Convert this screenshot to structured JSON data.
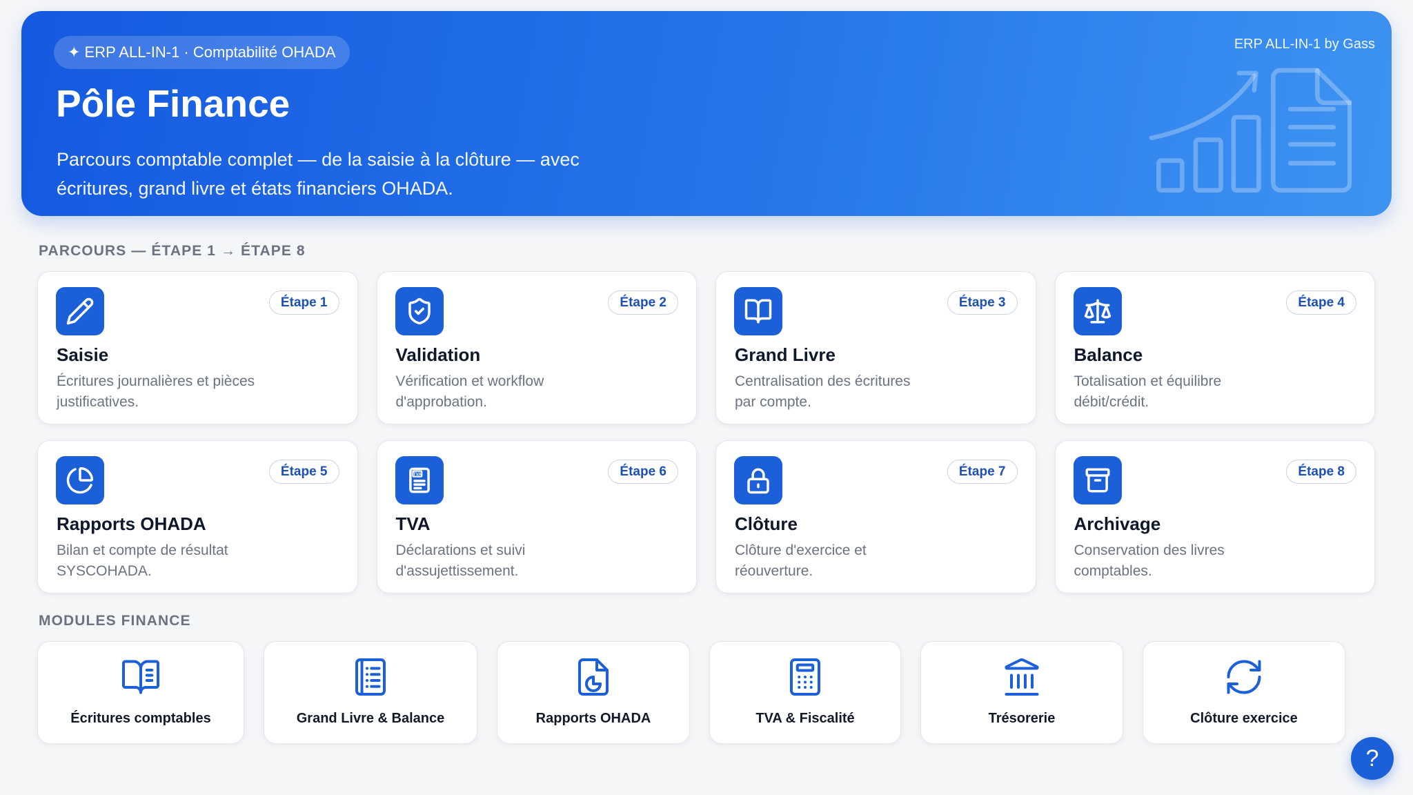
{
  "colors": {
    "accent": "#1b5fd9",
    "header_gradient_start": "#1559e0",
    "header_gradient_mid": "#2676ea",
    "header_gradient_end": "#3e93f1",
    "page_background": "#f5f6f8",
    "step_badge_text": "#1d4fb8"
  },
  "header": {
    "badge": "✦ ERP ALL-IN-1 · Comptabilité OHADA",
    "title": "Pôle Finance",
    "subtitle": "Parcours comptable complet — de la saisie à la clôture — avec\nécritures, grand livre et états financiers OHADA.",
    "brand": "ERP ALL-IN-1 by Gass",
    "illustration_icon": "growth-chart-document-icon"
  },
  "journey": {
    "label": "PARCOURS — ÉTAPE 1 → ÉTAPE 8",
    "steps": [
      {
        "step": "Étape 1",
        "title": "Saisie",
        "desc": "Écritures journalières et pièces\njustificatives.",
        "icon": "pencil-icon"
      },
      {
        "step": "Étape 2",
        "title": "Validation",
        "desc": "Vérification et workflow\nd'approbation.",
        "icon": "shield-check-icon"
      },
      {
        "step": "Étape 3",
        "title": "Grand Livre",
        "desc": "Centralisation des écritures\npar compte.",
        "icon": "book-open-icon"
      },
      {
        "step": "Étape 4",
        "title": "Balance",
        "desc": "Totalisation et équilibre\ndébit/crédit.",
        "icon": "scale-icon"
      },
      {
        "step": "Étape 5",
        "title": "Rapports OHADA",
        "desc": "Bilan et compte de résultat\nSYSCOHADA.",
        "icon": "pie-chart-icon"
      },
      {
        "step": "Étape 6",
        "title": "TVA",
        "desc": "Déclarations et suivi\nd'assujettissement.",
        "icon": "tax-document-icon",
        "icon_label": "TVA"
      },
      {
        "step": "Étape 7",
        "title": "Clôture",
        "desc": "Clôture d'exercice et\nréouverture.",
        "icon": "lock-icon"
      },
      {
        "step": "Étape 8",
        "title": "Archivage",
        "desc": "Conservation des livres\ncomptables.",
        "icon": "archive-box-icon"
      }
    ]
  },
  "modules": {
    "label": "MODULES FINANCE",
    "items": [
      {
        "label": "Écritures comptables",
        "icon": "book-open-text-icon"
      },
      {
        "label": "Grand Livre & Balance",
        "icon": "ledger-icon"
      },
      {
        "label": "Rapports OHADA",
        "icon": "report-chart-icon"
      },
      {
        "label": "TVA & Fiscalité",
        "icon": "calculator-icon"
      },
      {
        "label": "Trésorerie",
        "icon": "bank-icon"
      },
      {
        "label": "Clôture exercice",
        "icon": "refresh-icon"
      }
    ]
  },
  "help": {
    "label": "?"
  }
}
